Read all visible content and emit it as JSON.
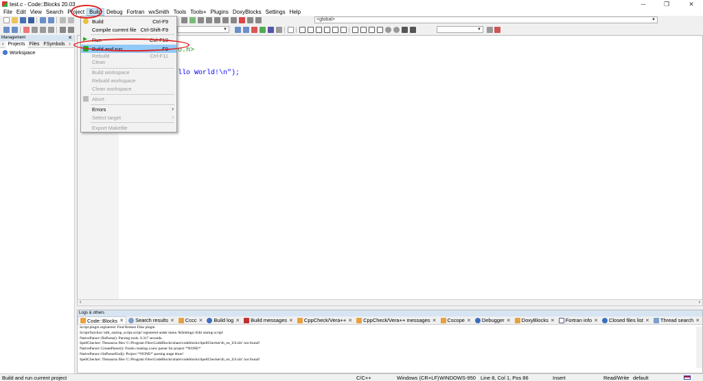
{
  "window": {
    "title": "test.c - Code::Blocks 20.03",
    "minimize": "─",
    "maximize": "❐",
    "close": "✕"
  },
  "menubar": [
    "File",
    "Edit",
    "View",
    "Search",
    "Project",
    "Build",
    "Debug",
    "Fortran",
    "wxSmith",
    "Tools",
    "Tools+",
    "Plugins",
    "DoxyBlocks",
    "Settings",
    "Help"
  ],
  "toolbar": {
    "scope_combo": "<global>"
  },
  "sidebar": {
    "header": "Management",
    "tabs": [
      "Projects",
      "Files",
      "FSymbols"
    ],
    "workspace": "Workspace"
  },
  "editor": {
    "line1": "o.h>",
    "line2": "llo World!\\n\");",
    "scroll_left": "‹",
    "scroll_right": "›"
  },
  "build_menu": {
    "items": [
      {
        "label": "Build",
        "shortcut": "Ctrl-F9"
      },
      {
        "label": "Compile current file",
        "shortcut": "Ctrl-Shift-F9"
      },
      {
        "label": "Run",
        "shortcut": "Ctrl-F10"
      },
      {
        "label": "Build and run",
        "shortcut": "F9"
      },
      {
        "label": "Rebuild",
        "shortcut": "Ctrl-F11"
      },
      {
        "label": "Clean",
        "shortcut": ""
      },
      {
        "label": "Build workspace",
        "shortcut": ""
      },
      {
        "label": "Rebuild workspace",
        "shortcut": ""
      },
      {
        "label": "Clean workspace",
        "shortcut": ""
      },
      {
        "label": "Abort",
        "shortcut": ""
      },
      {
        "label": "Errors",
        "shortcut": ""
      },
      {
        "label": "Select target",
        "shortcut": ""
      },
      {
        "label": "Export Makefile",
        "shortcut": ""
      }
    ]
  },
  "logs": {
    "header": "Logs & others",
    "tabs": [
      "Code::Blocks",
      "Search results",
      "Cccc",
      "Build log",
      "Build messages",
      "CppCheck/Vera++",
      "CppCheck/Vera++ messages",
      "Cscope",
      "Debugger",
      "DoxyBlocks",
      "Fortran info",
      "Closed files list",
      "Thread search"
    ],
    "lines": [
      "Script plugin registered: Find Broken Files plugin",
      "Script/function 'edit_startup_script.script' registered under menu '&Settings/-Edit startup script'",
      "NativeParser::DoParse(): Parsing tools: 0.317 seconds.",
      "SpellChecker: Thesaurus files 'C:\\Program Files\\CodeBlocks\\share\\codeblocks\\SpellChecker\\th_en_US.idx' not found!",
      "NativeParser::CreateParser(): Finish creating a new parser for project '*NONE*'",
      "NativeParser::OnParserEnd(): Project '*NONE*' parsing stage done!",
      "SpellChecker: Thesaurus files 'C:\\Program Files\\CodeBlocks\\share\\codeblocks\\SpellChecker\\th_en_US.idx' not found!"
    ]
  },
  "statusbar": {
    "message": "Build and run current project",
    "language": "C/C++",
    "eol": "Windows (CR+LF)",
    "encoding": "WINDOWS-950",
    "position": "Line 8, Col 1, Pos 86",
    "mode": "Insert",
    "access": "Read/Write",
    "profile": "default"
  },
  "colors": {
    "highlight": "#91c9f7",
    "annotation": "#e02020",
    "string": "#0000ff"
  }
}
